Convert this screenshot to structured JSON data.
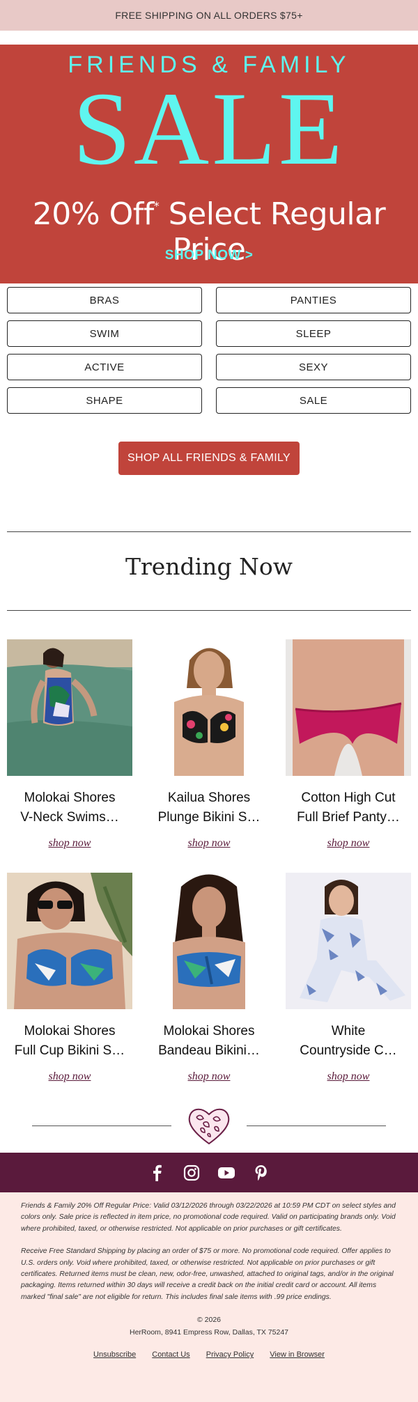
{
  "shipping_bar": "FREE SHIPPING ON ALL ORDERS $75+",
  "hero": {
    "kicker": "FRIENDS & FAMILY",
    "headline": "SALE",
    "offer_main": "20% Off",
    "offer_mark": "*",
    "offer_rest": " Select Regular Price",
    "cta": "SHOP NOW >",
    "bg_color": "#c0443b",
    "accent_color": "#5ff5ef"
  },
  "categories": [
    "BRAS",
    "PANTIES",
    "SWIM",
    "SLEEP",
    "ACTIVE",
    "SEXY",
    "SHAPE",
    "SALE"
  ],
  "shop_all": "SHOP ALL FRIENDS & FAMILY",
  "trending_title": "Trending Now",
  "products": [
    {
      "line1": "Molokai Shores",
      "line2": "V-Neck Swims…",
      "cta": "shop now"
    },
    {
      "line1": "Kailua Shores",
      "line2": "Plunge Bikini S…",
      "cta": "shop now"
    },
    {
      "line1": "Cotton High Cut",
      "line2": "Full Brief Panty…",
      "cta": "shop now"
    },
    {
      "line1": "Molokai Shores",
      "line2": "Full Cup Bikini S…",
      "cta": "shop now"
    },
    {
      "line1": "Molokai Shores",
      "line2": "Bandeau Bikini…",
      "cta": "shop now"
    },
    {
      "line1": "White",
      "line2": "Countryside C…",
      "cta": "shop now"
    }
  ],
  "social": {
    "icons": [
      "facebook-icon",
      "instagram-icon",
      "youtube-icon",
      "pinterest-icon"
    ],
    "bg_color": "#5a1a3c"
  },
  "legal": {
    "para1": "Friends & Family 20% Off Regular Price: Valid 03/12/2026 through 03/22/2026 at 10:59 PM CDT on select styles and colors only. Sale price is reflected in item price, no promotional code required. Valid on participating brands only. Void where prohibited, taxed, or otherwise restricted. Not applicable on prior purchases or gift certificates.",
    "para2": "Receive Free Standard Shipping by placing an order of $75 or more. No promotional code required. Offer applies to U.S. orders only. Void where prohibited, taxed, or otherwise restricted. Not applicable on prior purchases or gift certificates. Returned items must be clean, new, odor-free, unwashed, attached to original tags, and/or in the original packaging. Items returned within 30 days will receive a credit back on the initial credit card or account. All items marked \"final sale\" are not eligible for return. This includes final sale items with .99 price endings.",
    "copyright": "© 2026",
    "address": "HerRoom, 8941 Empress Row, Dallas, TX 75247",
    "links": [
      "Unsubscribe",
      "Contact Us",
      "Privacy Policy",
      "View in Browser"
    ]
  }
}
